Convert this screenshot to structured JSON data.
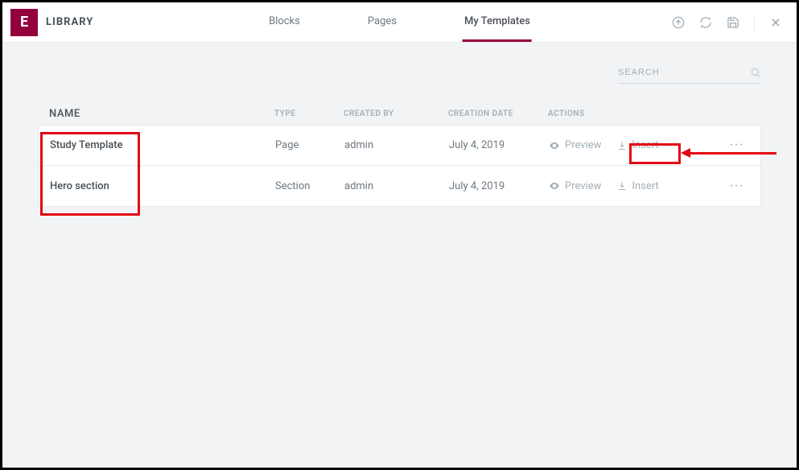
{
  "header": {
    "logo_letter": "E",
    "title": "LIBRARY",
    "tabs": [
      "Blocks",
      "Pages",
      "My Templates"
    ],
    "active_tab_index": 2
  },
  "search": {
    "placeholder": "SEARCH"
  },
  "table": {
    "columns": {
      "name": "NAME",
      "type": "TYPE",
      "created_by": "CREATED BY",
      "creation_date": "CREATION DATE",
      "actions": "ACTIONS"
    },
    "action_labels": {
      "preview": "Preview",
      "insert": "Insert"
    },
    "rows": [
      {
        "name": "Study Template",
        "type": "Page",
        "created_by": "admin",
        "creation_date": "July 4, 2019"
      },
      {
        "name": "Hero section",
        "type": "Section",
        "created_by": "admin",
        "creation_date": "July 4, 2019"
      }
    ]
  }
}
